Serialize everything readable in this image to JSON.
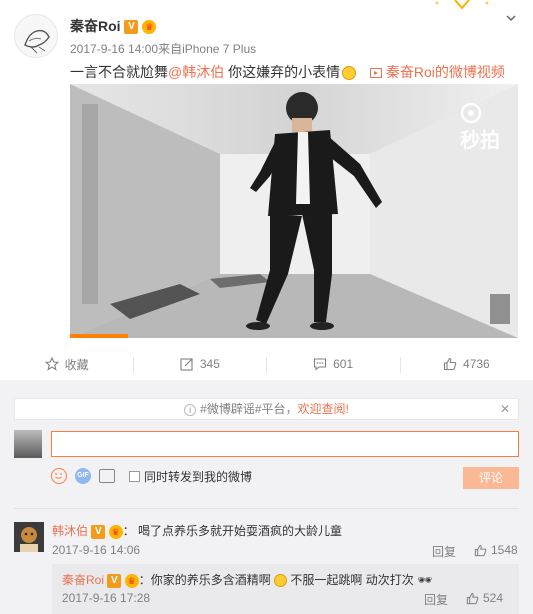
{
  "post": {
    "author": "秦奋Roi",
    "time": "2017-9-16 14:00",
    "source": "来自iPhone 7 Plus",
    "text_main": "一言不合就尬舞",
    "mention": "@韩沐伯",
    "text_tail": "你这嫌弃的小表情",
    "video_link": "秦奋Roi的微博视频",
    "video_watermark": "秒拍",
    "video_progress_fraction": 0.13
  },
  "actions": {
    "favorite_label": "收藏",
    "repost_count": "345",
    "comment_count": "601",
    "like_count": "4736"
  },
  "composer": {
    "notice_tags": "#微博辟谣#平台，",
    "notice_highlight": "欢迎查阅!",
    "input_value": "",
    "repost_label": "同时转发到我的微博",
    "submit_label": "评论"
  },
  "comments": [
    {
      "user": "韩沐伯",
      "text": "：  喝了点养乐多就开始耍酒疯的大龄儿童",
      "time": "2017-9-16 14:06",
      "reply_label": "回复",
      "likes": "1548",
      "reply": {
        "user": "秦奋Roi",
        "text": "：你家的养乐多含酒精啊",
        "text_tail": "不服一起跳啊 动次打次",
        "time": "2017-9-16 17:28",
        "reply_label": "回复",
        "likes": "524"
      }
    }
  ],
  "colors": {
    "accent": "#eb7350",
    "input_border": "#fa7d3c",
    "submit_disabled": "#fbb895",
    "video_progress": "#ff8200"
  }
}
